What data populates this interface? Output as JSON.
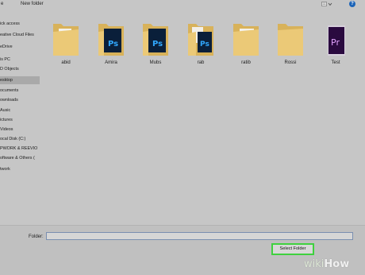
{
  "toolbar": {
    "left_partial": "e",
    "new_folder": "New folder",
    "help_icon": "?"
  },
  "sidebar": {
    "items": [
      {
        "label": "ick access",
        "selected": false
      },
      {
        "label": "eative Cloud Files",
        "selected": false
      },
      {
        "label": "eDrive",
        "selected": false
      },
      {
        "label": "is PC",
        "selected": false
      },
      {
        "label": "D Objects",
        "selected": false
      },
      {
        "label": "esktop",
        "selected": true
      },
      {
        "label": "ocuments",
        "selected": false
      },
      {
        "label": "ownloads",
        "selected": false
      },
      {
        "label": "Ausic",
        "selected": false
      },
      {
        "label": "ictures",
        "selected": false
      },
      {
        "label": "Videos",
        "selected": false
      },
      {
        "label": "ocal Disk (C:)",
        "selected": false
      },
      {
        "label": "PWORK & REEVIO",
        "selected": false
      },
      {
        "label": "oftware & Others (",
        "selected": false
      },
      {
        "label": "twork",
        "selected": false
      }
    ]
  },
  "items": [
    {
      "name": "abid",
      "icon": "folder-icon"
    },
    {
      "name": "Amira",
      "icon": "photoshop-folder-icon"
    },
    {
      "name": "Mubs",
      "icon": "photoshop-folder-icon"
    },
    {
      "name": "rab",
      "icon": "photoshop-image-folder-icon"
    },
    {
      "name": "ratib",
      "icon": "folder-icon"
    },
    {
      "name": "Rossi",
      "icon": "folder-icon"
    },
    {
      "name": "Test",
      "icon": "premiere-icon"
    }
  ],
  "footer": {
    "folder_label": "Folder:",
    "folder_value": "",
    "select_button": "Select Folder"
  },
  "watermark": {
    "wiki": "wiki",
    "how": "How"
  },
  "colors": {
    "highlight": "#3fd13f",
    "photoshop": "#0a1f3a",
    "photoshop_text": "#31a8ff",
    "premiere": "#2a0a3f",
    "premiere_text": "#e3a3ff",
    "folder": "#e8c670"
  }
}
